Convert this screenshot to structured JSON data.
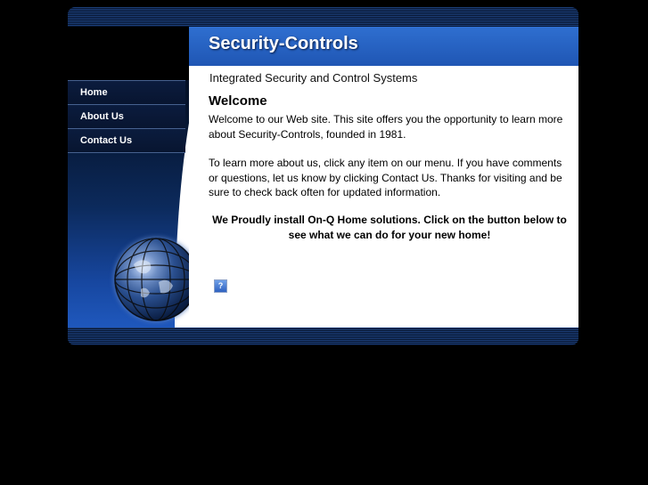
{
  "site": {
    "title": "Security-Controls",
    "tagline": "Integrated Security and Control Systems"
  },
  "menu": {
    "items": [
      {
        "label": "Home"
      },
      {
        "label": "About Us"
      },
      {
        "label": "Contact Us"
      }
    ]
  },
  "content": {
    "heading": "Welcome",
    "paragraph1": "Welcome to our Web site. This site offers you the opportunity to learn more about Security-Controls, founded in 1981.",
    "paragraph2": "To learn more about us, click any item on our menu. If you have comments or questions, let us know by clicking Contact Us. Thanks for visiting and be sure to check back often for updated information.",
    "highlight": "We  Proudly install On-Q Home solutions. Click on the button below to see what we can do for your new home!",
    "image_placeholder": "?"
  },
  "icons": {
    "globe": "globe-icon",
    "broken_image": "broken-image-icon"
  },
  "colors": {
    "background": "#000000",
    "header_blue": "#2563c4",
    "content_bg": "#ffffff",
    "menu_text": "#ffffff"
  }
}
